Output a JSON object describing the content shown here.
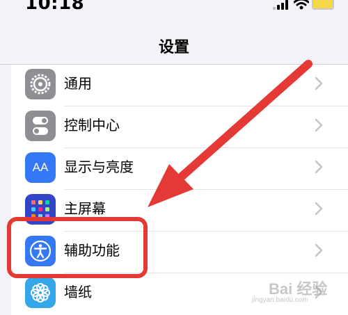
{
  "status_bar": {
    "time": "10:18",
    "battery_color": "#f7d84a"
  },
  "nav": {
    "title": "设置"
  },
  "settings": {
    "items": [
      {
        "label": "通用",
        "icon": "gear-icon",
        "icon_bg": "#8e8e93"
      },
      {
        "label": "控制中心",
        "icon": "toggle-switches-icon",
        "icon_bg": "#8e8e93"
      },
      {
        "label": "显示与亮度",
        "icon": "text-size-aa-icon",
        "icon_bg": "#3478f6"
      },
      {
        "label": "主屏幕",
        "icon": "app-grid-icon",
        "icon_bg": "#3245c8"
      },
      {
        "label": "辅助功能",
        "icon": "accessibility-icon",
        "icon_bg": "#3478f6"
      },
      {
        "label": "墙纸",
        "icon": "flower-icon",
        "icon_bg": "#35a7e8"
      }
    ],
    "icon_text": {
      "aa": "AA"
    }
  },
  "annotation": {
    "color": "#e53935"
  },
  "watermark": {
    "main": "Bai 经验",
    "sub": "jingyan.baidu.com"
  }
}
